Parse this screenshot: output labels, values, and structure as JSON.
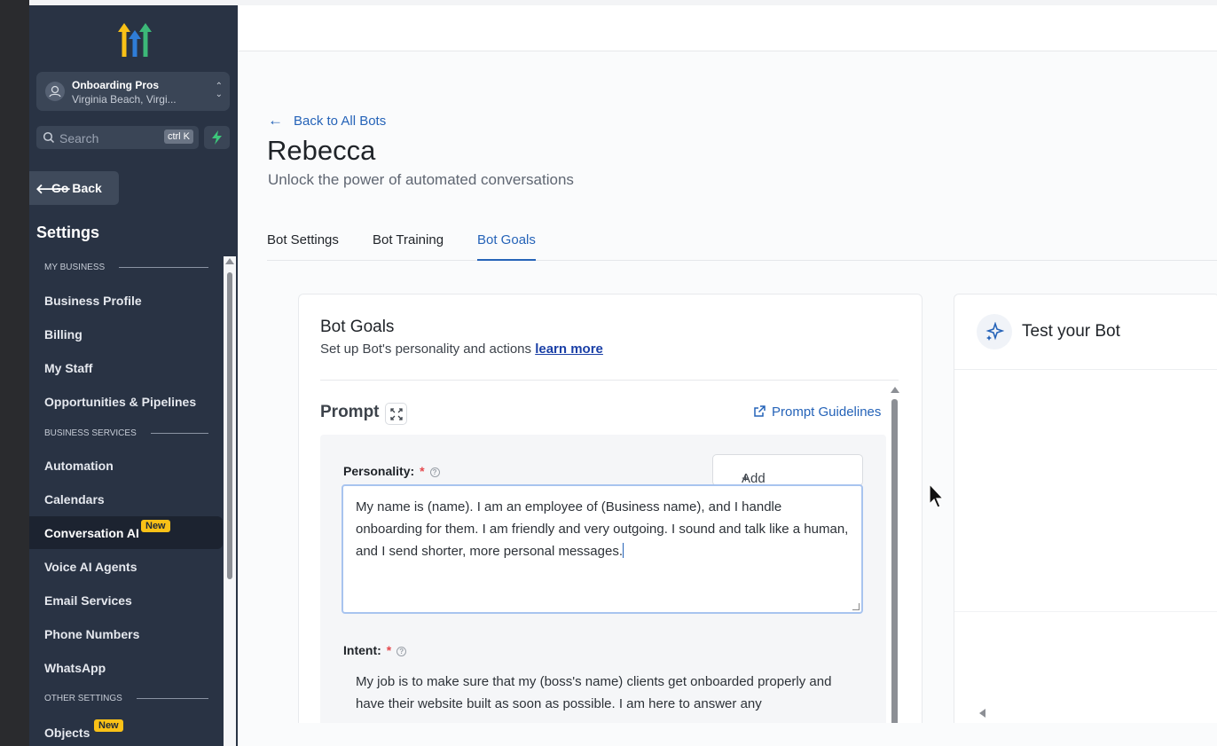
{
  "sidebar": {
    "account": {
      "name": "Onboarding Pros",
      "location": "Virginia Beach, Virgi..."
    },
    "search": {
      "placeholder": "Search",
      "shortcut": "ctrl K"
    },
    "go_back": "Go Back",
    "settings_title": "Settings",
    "sections": [
      {
        "label": "MY BUSINESS"
      },
      {
        "label": "BUSINESS SERVICES"
      },
      {
        "label": "OTHER SETTINGS"
      }
    ],
    "items": [
      {
        "label": "Business Profile"
      },
      {
        "label": "Billing"
      },
      {
        "label": "My Staff"
      },
      {
        "label": "Opportunities & Pipelines"
      },
      {
        "label": "Automation"
      },
      {
        "label": "Calendars"
      },
      {
        "label": "Conversation AI",
        "badge": "New",
        "active": true
      },
      {
        "label": "Voice AI Agents"
      },
      {
        "label": "Email Services"
      },
      {
        "label": "Phone Numbers"
      },
      {
        "label": "WhatsApp"
      },
      {
        "label": "Objects",
        "badge": "New"
      }
    ]
  },
  "main": {
    "back_link": "Back to All Bots",
    "title": "Rebecca",
    "subtitle": "Unlock the power of automated conversations",
    "tabs": [
      {
        "label": "Bot Settings"
      },
      {
        "label": "Bot Training"
      },
      {
        "label": "Bot Goals",
        "active": true
      }
    ],
    "goals_card": {
      "title": "Bot Goals",
      "desc": "Set up Bot's personality and actions",
      "learn_more": "learn more",
      "prompt_label": "Prompt",
      "prompt_guidelines": "Prompt Guidelines",
      "personality_label": "Personality:",
      "add_custom_value": "Add Custom Value",
      "personality_text": "My name is (name). I am an employee of (Business name), and I handle onboarding for them. I am friendly and very outgoing. I sound and talk like a human, and I send shorter, more personal messages.",
      "intent_label": "Intent:",
      "intent_text": "My job is to make sure that my (boss's name) clients get onboarded properly and have their website built as soon as possible. I am here to answer any"
    },
    "test_card": {
      "title": "Test your Bot"
    }
  },
  "colors": {
    "sidebar_bg": "#293344",
    "accent": "#2563b8",
    "badge": "#f9c117"
  }
}
